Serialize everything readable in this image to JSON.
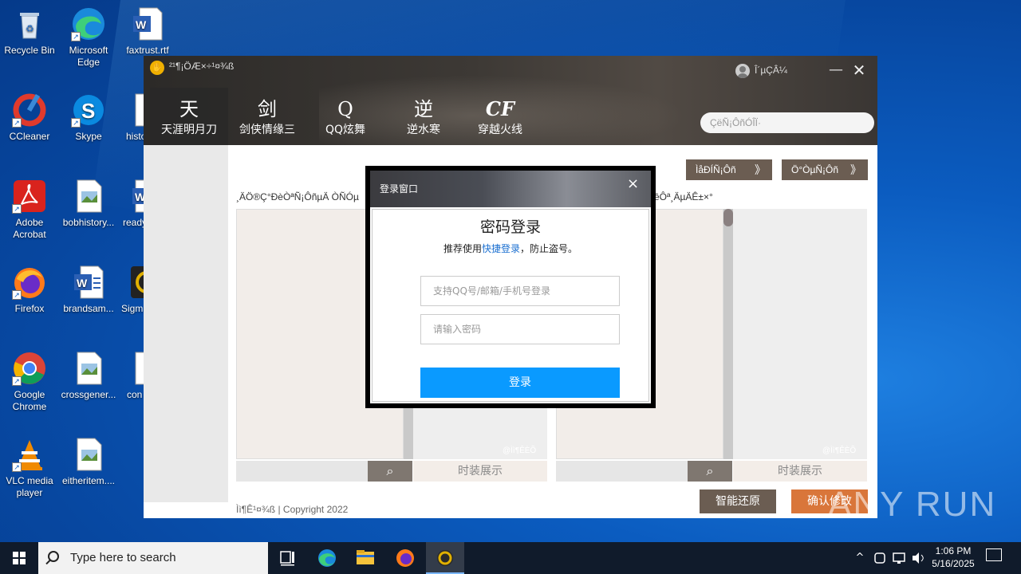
{
  "desktop": {
    "icons": [
      {
        "label": "Recycle Bin",
        "icon": "recycle-bin-icon"
      },
      {
        "label": "Microsoft Edge",
        "icon": "edge-icon"
      },
      {
        "label": "faxtrust.rtf",
        "icon": "word-doc-icon"
      },
      {
        "label": "CCleaner",
        "icon": "ccleaner-icon"
      },
      {
        "label": "Skype",
        "icon": "skype-icon"
      },
      {
        "label": "histo",
        "icon": "file-icon"
      },
      {
        "label": "Adobe Acrobat",
        "icon": "acrobat-icon"
      },
      {
        "label": "bobhistory...",
        "icon": "image-file-icon"
      },
      {
        "label": "ready",
        "icon": "word-doc-icon"
      },
      {
        "label": "Firefox",
        "icon": "firefox-icon"
      },
      {
        "label": "brandsam...",
        "icon": "word-doc-icon"
      },
      {
        "label": "Sigm",
        "icon": "app-icon"
      },
      {
        "label": "Google Chrome",
        "icon": "chrome-icon"
      },
      {
        "label": "crossgener...",
        "icon": "image-file-icon"
      },
      {
        "label": "con",
        "icon": "file-icon"
      },
      {
        "label": "VLC media player",
        "icon": "vlc-icon"
      },
      {
        "label": "eitheritem....",
        "icon": "image-file-icon"
      }
    ]
  },
  "app": {
    "title": "²¹¶¡ÖÆ×÷¹¤¾ß",
    "user_name": "Î´µÇÂ¼",
    "min_glyph": "—",
    "close_glyph": "✕",
    "tabs": [
      {
        "label": "天涯明月刀",
        "glyph": "天",
        "active": true
      },
      {
        "label": "剑侠情缘三",
        "glyph": "剑"
      },
      {
        "label": "QQ炫舞",
        "glyph": "Q"
      },
      {
        "label": "逆水寒",
        "glyph": "逆"
      },
      {
        "label": "穿越火线",
        "glyph": "CF"
      }
    ],
    "search_placeholder": "ÇëÑ¡ÔñÓÎÏ·",
    "top_buttons": [
      "ÌåÐÍÑ¡Ôñ",
      "Ö°ÒµÑ¡Ôñ"
    ],
    "chev_glyph": "》",
    "note_left": "¸ÄÖ®Ç°ÐèÒªÑ¡ÔñµÄ ÒÑÓµ",
    "note_right": "êÔª¸ÄµÄÊ±×°",
    "watermark": "@Ìì¶ÊÈÕ",
    "search_glyph": "⌕",
    "show_label": "时装展示",
    "footer": "Ìì¶Ê¹¤¾ß | Copyright 2022",
    "btn_restore": "智能还原",
    "btn_confirm": "确认修改"
  },
  "modal": {
    "title": "登录窗口",
    "close": "×",
    "heading": "密码登录",
    "sub_prefix": "推荐使用",
    "sub_link": "快捷登录",
    "sub_suffix": "，防止盗号。",
    "account_placeholder": "支持QQ号/邮箱/手机号登录",
    "password_placeholder": "请输入密码",
    "login_label": "登录"
  },
  "taskbar": {
    "search_placeholder": "Type here to search",
    "time": "1:06 PM",
    "date": "5/16/2025",
    "chevron": "^"
  },
  "watermark_brand": "ANY RUN",
  "colors": {
    "brown_btn": "#6b5d52",
    "orange_btn": "#d9763a",
    "login_blue": "#0a9aff"
  }
}
